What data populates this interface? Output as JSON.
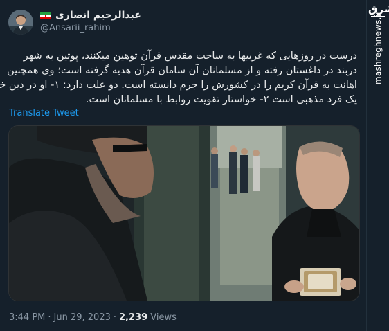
{
  "author": {
    "display_name": "عبدالرحیم انصاری",
    "handle": "@Ansarii_rahim",
    "flag": "iran-flag"
  },
  "tweet": {
    "lines": [
      "درست در روزهایی که غربیها به ساحت مقدس قرآن توهین میکنند، پوتین به شهر",
      "دربند در داغستان رفته و از مسلمانان آن سامان قرآن هدیه گرفته است؛ وی همچنین",
      "اهانت به قرآن کریم را در کشورش را جرم دانسته است. دو علت دارد: ۱- او در دین خود",
      "یک فرد مذهبی است ۲- خواستار تقویت روابط با مسلمانان است."
    ],
    "translate_label": "Translate Tweet"
  },
  "meta": {
    "time": "3:44 PM",
    "date": "Jun 29, 2023",
    "separator": "·",
    "views_count": "2,239",
    "views_label": "Views"
  },
  "watermark": {
    "logo_text": "مشرق",
    "site": "mashreghnews.ir"
  },
  "colors": {
    "background": "#15202b",
    "text": "#e7e9ea",
    "muted": "#8b98a5",
    "link": "#1d9bf0"
  }
}
